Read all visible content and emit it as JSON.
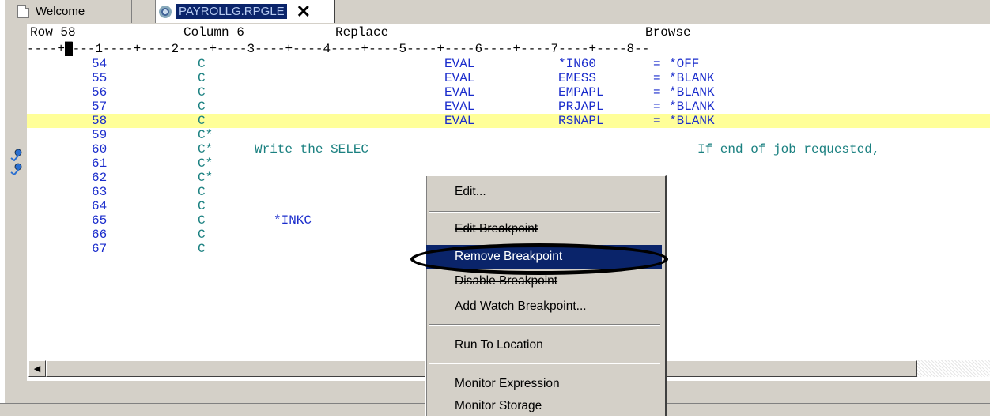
{
  "tabs": [
    {
      "label": "Welcome",
      "icon": "document-icon",
      "active": false
    },
    {
      "label": "PAYROLLG.RPGLE",
      "icon": "gear-icon",
      "active": true,
      "close": "✕"
    }
  ],
  "status": {
    "row": "Row 58",
    "column": "Column 6",
    "mode": "Replace",
    "browse": "Browse"
  },
  "ruler": {
    "before": "----+",
    "cursor": "█",
    "after": "---1----+----2----+----3----+----4----+----5----+----6----+----7----+----8--"
  },
  "code": [
    {
      "n": "54",
      "spec": "C",
      "op": "EVAL",
      "f1": "*IN60",
      "eq": "=",
      "f2": "*OFF"
    },
    {
      "n": "55",
      "spec": "C",
      "op": "EVAL",
      "f1": "EMESS",
      "eq": "=",
      "f2": "*BLANK"
    },
    {
      "n": "56",
      "spec": "C",
      "op": "EVAL",
      "f1": "EMPAPL",
      "eq": "=",
      "f2": "*BLANK"
    },
    {
      "n": "57",
      "spec": "C",
      "op": "EVAL",
      "f1": "PRJAPL",
      "eq": "=",
      "f2": "*BLANK"
    },
    {
      "n": "58",
      "spec": "C",
      "op": "EVAL",
      "f1": "RSNAPL",
      "eq": "=",
      "f2": "*BLANK"
    },
    {
      "n": "59",
      "spec": "C*"
    },
    {
      "n": "60",
      "spec": "C*",
      "comment": "Write the SELEC",
      "comment2": "If end of job requested,"
    },
    {
      "n": "61",
      "spec": "C*"
    },
    {
      "n": "62",
      "spec": "C*"
    },
    {
      "n": "63",
      "spec": "C"
    },
    {
      "n": "64",
      "spec": "C"
    },
    {
      "n": "65",
      "spec": "C",
      "kw": "*INKC"
    },
    {
      "n": "66",
      "spec": "C"
    },
    {
      "n": "67",
      "spec": "C"
    }
  ],
  "menu": {
    "items": [
      {
        "label": "Edit..."
      },
      {
        "label": "Edit Breakpoint"
      },
      {
        "label": "Remove Breakpoint",
        "selected": true
      },
      {
        "label": "Disable Breakpoint"
      },
      {
        "label": "Add Watch Breakpoint..."
      },
      {
        "label": "Run To Location"
      },
      {
        "label": "Monitor Expression"
      },
      {
        "label": "Monitor Storage"
      }
    ]
  },
  "colors": {
    "highlight_line": "#ffff99",
    "selection": "#0a246a",
    "code_blue": "#1a2ccc",
    "comment_teal": "#1a8080"
  }
}
